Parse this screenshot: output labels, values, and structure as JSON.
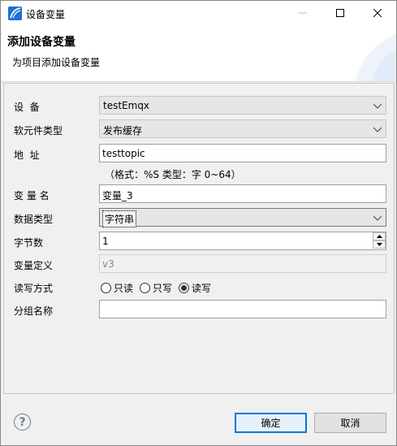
{
  "window": {
    "title": "设备变量"
  },
  "banner": {
    "title": "添加设备变量",
    "subtitle": "为项目添加设备变量"
  },
  "form": {
    "device": {
      "label": "设  备",
      "value": "testEmqx"
    },
    "component_type": {
      "label": "软元件类型",
      "value": "发布缓存"
    },
    "address": {
      "label": "地  址",
      "value": "testtopic"
    },
    "hint": "（格式：%S 类型：字 0~64）",
    "var_name": {
      "label": "变 量 名",
      "value": "变量_3"
    },
    "data_type": {
      "label": "数据类型",
      "value": "字符串"
    },
    "byte_count": {
      "label": "字节数",
      "value": "1"
    },
    "var_def": {
      "label": "变量定义",
      "value": "v3"
    },
    "rw_mode": {
      "label": "读写方式",
      "options": [
        "只读",
        "只写",
        "读写"
      ],
      "selected": "读写"
    },
    "group_name": {
      "label": "分组名称",
      "value": ""
    }
  },
  "footer": {
    "ok_label": "确定",
    "cancel_label": "取消",
    "help_symbol": "?"
  },
  "colors": {
    "accent": "#0078d7",
    "app_icon": "#1f6fd1"
  }
}
